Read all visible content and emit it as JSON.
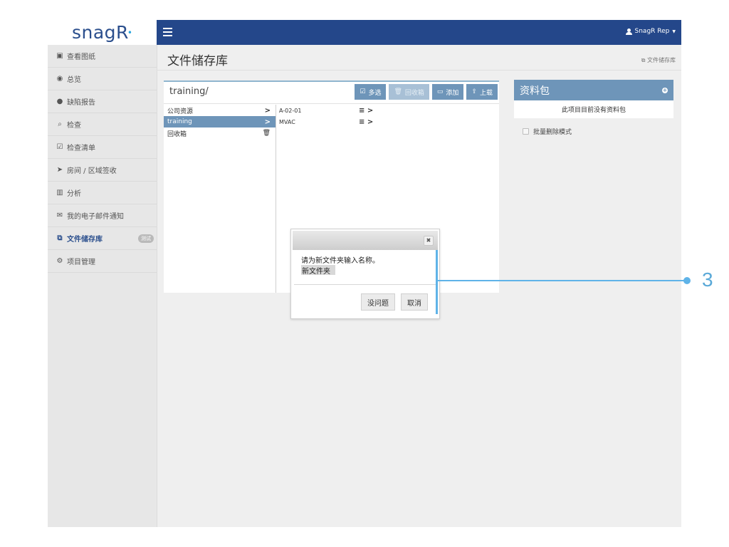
{
  "app": {
    "logo_text": "snagR"
  },
  "topbar": {
    "user_label": "SnagR Rep"
  },
  "sidebar": {
    "items": [
      {
        "icon": "▣",
        "label": "查看图纸"
      },
      {
        "icon": "◉",
        "label": "总览"
      },
      {
        "icon": "●",
        "label": "缺陷报告"
      },
      {
        "icon": "⌕",
        "label": "检查"
      },
      {
        "icon": "☑",
        "label": "检查清单"
      },
      {
        "icon": "➤",
        "label": "房间 / 区域签收"
      },
      {
        "icon": "▥",
        "label": "分析"
      },
      {
        "icon": "✉",
        "label": "我的电子邮件通知"
      },
      {
        "icon": "⧉",
        "label": "文件储存库",
        "badge": "测试"
      },
      {
        "icon": "⚙",
        "label": "项目管理"
      }
    ]
  },
  "page": {
    "title": "文件储存库",
    "breadcrumb": "文件储存库"
  },
  "files": {
    "path": "training/",
    "toolbar": {
      "multiselect": "多选",
      "recycle": "回收箱",
      "add": "添加",
      "upload": "上载"
    },
    "folders": [
      {
        "name": "公司资源"
      },
      {
        "name": "training"
      },
      {
        "name": "回收箱"
      }
    ],
    "items": [
      {
        "name": "A-02-01"
      },
      {
        "name": "MVAC"
      }
    ]
  },
  "packages": {
    "title": "资料包",
    "empty_text": "此项目目前没有资料包",
    "bulk_delete_label": "批量删除模式"
  },
  "dialog": {
    "message": "请为新文件夹输入名称。",
    "input_value": "新文件夹",
    "ok_label": "没问题",
    "cancel_label": "取消"
  },
  "callout": {
    "number": "3"
  },
  "colors": {
    "nav_blue": "#24478a",
    "panel_blue": "#6e95b9",
    "callout_blue": "#5fb3e8"
  }
}
